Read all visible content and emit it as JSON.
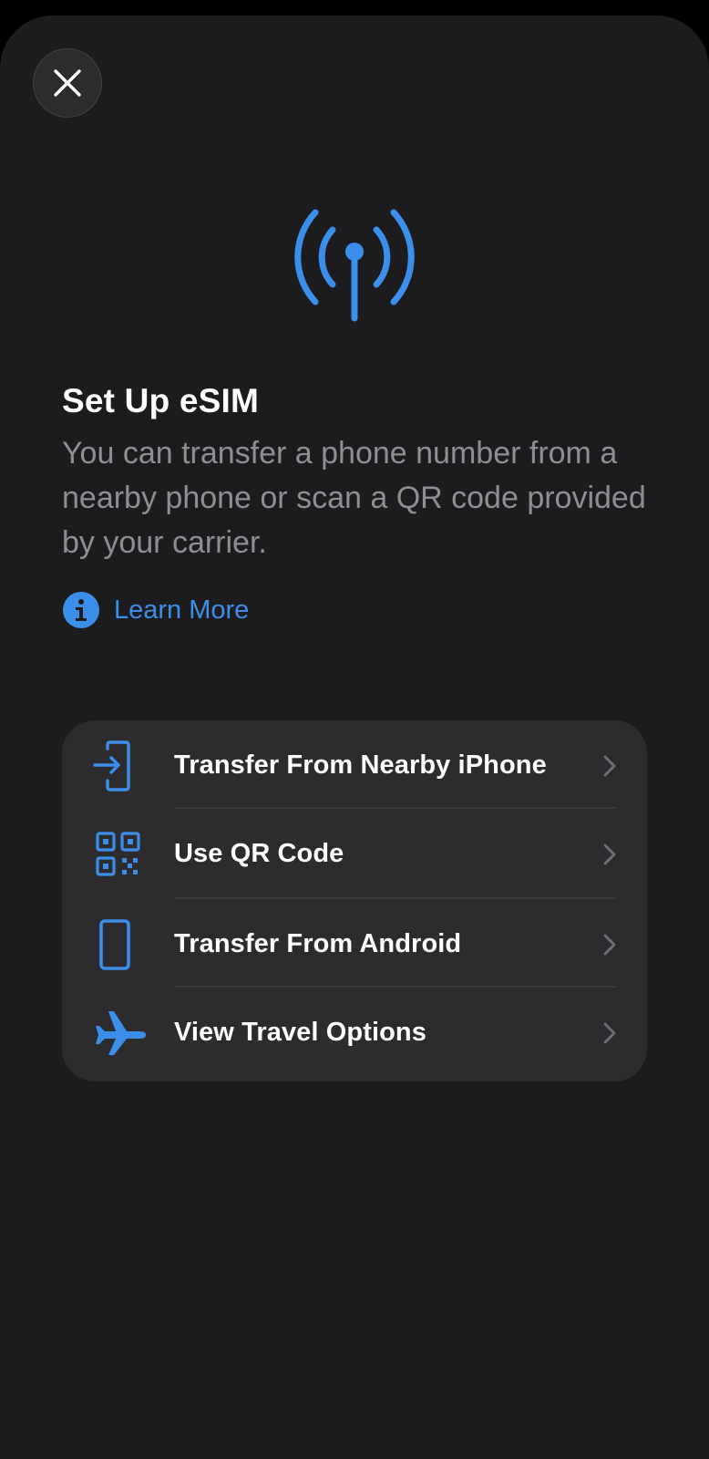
{
  "screen": {
    "title": "Set Up eSIM",
    "description": "You can transfer a phone number from a nearby phone or scan a QR code provided by your carrier.",
    "learn_more": "Learn More"
  },
  "icons": {
    "close": "close-icon",
    "hero": "cellular-antenna-icon",
    "info": "info-circle-icon",
    "chevron": "chevron-right-icon"
  },
  "colors": {
    "accent": "#3b8eea",
    "background": "#1c1c1e",
    "card": "#2c2c2e",
    "secondary_text": "#8e8e93"
  },
  "options": [
    {
      "label": "Transfer From Nearby iPhone",
      "icon": "transfer-in-icon"
    },
    {
      "label": "Use QR Code",
      "icon": "qr-code-icon"
    },
    {
      "label": "Transfer From Android",
      "icon": "phone-outline-icon"
    },
    {
      "label": "View Travel Options",
      "icon": "airplane-icon"
    }
  ]
}
